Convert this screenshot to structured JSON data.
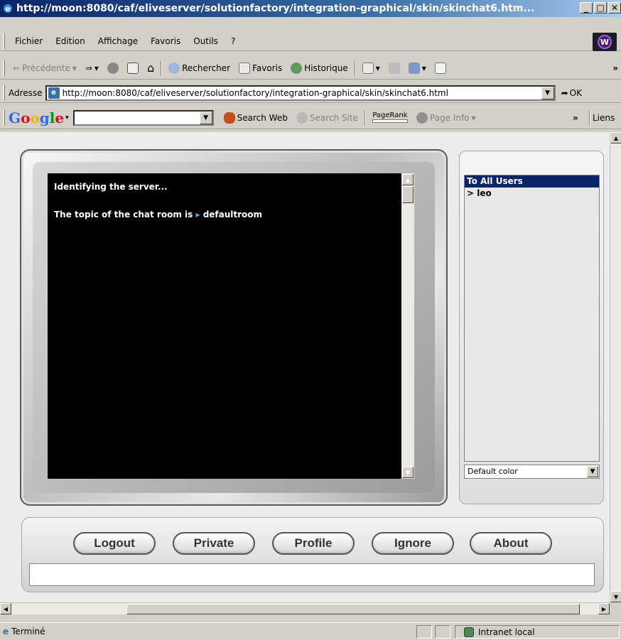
{
  "window": {
    "title": "http://moon:8080/caf/eliveserver/solutionfactory/integration-graphical/skin/skinchat6.htm...",
    "minimize": "_",
    "maximize": "□",
    "close": "✕"
  },
  "menu": {
    "items": [
      "Fichier",
      "Edition",
      "Affichage",
      "Favoris",
      "Outils",
      "?"
    ],
    "logo_letter": "W"
  },
  "toolbar": {
    "back": "Précédente",
    "search": "Rechercher",
    "favorites": "Favoris",
    "history": "Historique",
    "more": "»"
  },
  "address": {
    "label": "Adresse",
    "url": "http://moon:8080/caf/eliveserver/solutionfactory/integration-graphical/skin/skinchat6.html",
    "go": "OK"
  },
  "google": {
    "logo": "Google",
    "search_web": "Search Web",
    "search_site": "Search Site",
    "pagerank": "PageRank",
    "page_info": "Page Info",
    "more": "»",
    "links": "Liens"
  },
  "chat": {
    "line1": "Identifying the server...",
    "line2_prefix": "The topic of the chat room is",
    "line2_arrow": "▸",
    "line2_topic": "defaultroom"
  },
  "users": {
    "items": [
      "To All Users",
      "> leo"
    ],
    "color_select": "Default color"
  },
  "buttons": {
    "logout": "Logout",
    "private": "Private",
    "profile": "Profile",
    "ignore": "Ignore",
    "about": "About"
  },
  "message_input": {
    "value": ""
  },
  "status": {
    "text": "Terminé",
    "zone": "Intranet local"
  },
  "colors": {
    "titlebar": "#0a246a",
    "chat_bg": "#000000",
    "selected_user": "#0a246a"
  }
}
